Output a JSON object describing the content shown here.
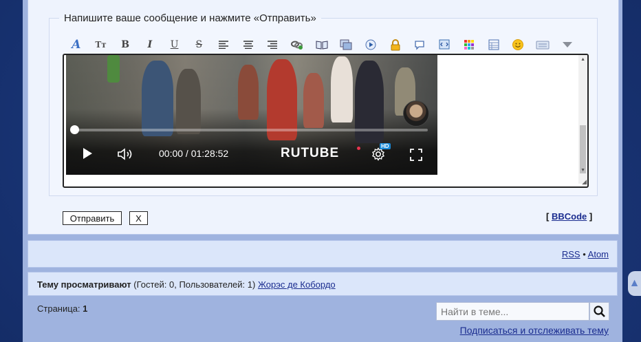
{
  "reply": {
    "legend": "Напишите ваше сообщение и нажмите «Отправить»",
    "toolbar": [
      {
        "name": "font-icon",
        "glyph": "A"
      },
      {
        "name": "font-size-icon",
        "glyph": "Tт"
      },
      {
        "name": "bold-icon",
        "glyph": "B"
      },
      {
        "name": "italic-icon",
        "glyph": "I"
      },
      {
        "name": "underline-icon",
        "glyph": "U"
      },
      {
        "name": "strikethrough-icon",
        "glyph": "S"
      },
      {
        "name": "align-left-icon",
        "glyph": "≡"
      },
      {
        "name": "align-center-icon",
        "glyph": "≡"
      },
      {
        "name": "align-right-icon",
        "glyph": "≡"
      },
      {
        "name": "link-icon",
        "glyph": "🔗"
      },
      {
        "name": "book-icon",
        "glyph": "📖"
      },
      {
        "name": "image-icon",
        "glyph": "▣"
      },
      {
        "name": "media-icon",
        "glyph": "▶"
      },
      {
        "name": "lock-icon",
        "glyph": "🔒"
      },
      {
        "name": "quote-icon",
        "glyph": "💬"
      },
      {
        "name": "code-icon",
        "glyph": "⧉"
      },
      {
        "name": "color-icon",
        "glyph": "▦"
      },
      {
        "name": "table-icon",
        "glyph": "▤"
      },
      {
        "name": "smiley-icon",
        "glyph": "☺"
      },
      {
        "name": "keyboard-icon",
        "glyph": "⌨"
      },
      {
        "name": "more-dropdown-icon",
        "glyph": "▼"
      }
    ],
    "video": {
      "time": "00:00 / 01:28:52",
      "logo": "RUTUBE",
      "hd": "HD",
      "progress": 0
    },
    "submit_label": "Отправить",
    "cancel_label": "X",
    "bbcode_link": "BBCode",
    "bracket_open": "[",
    "bracket_close": "]"
  },
  "feeds": {
    "rss": "RSS",
    "separator": "•",
    "atom": "Atom"
  },
  "viewers": {
    "label": "Тему просматривают",
    "counts": "(Гостей: 0, Пользователей: 1)",
    "user": "Жорэс де Кобордо"
  },
  "pagination": {
    "label": "Страница:",
    "current": "1"
  },
  "search": {
    "placeholder": "Найти в теме..."
  },
  "subscribe_label": "Подписаться и отслеживать тему",
  "colors": {
    "link": "#1a2c8f",
    "panel": "#dbe6fa",
    "page_bg": "#9fb3df",
    "outer_bg": "#13295e",
    "rutube_accent": "#e8344e"
  }
}
